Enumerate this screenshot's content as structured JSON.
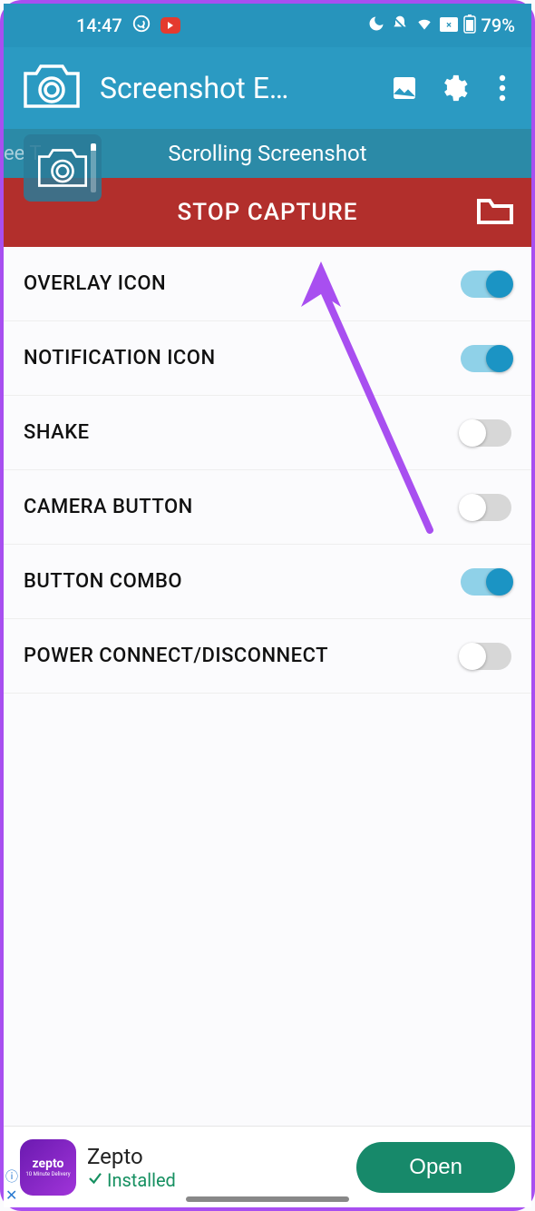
{
  "status": {
    "time": "14:47",
    "battery": "79%"
  },
  "appbar": {
    "title": "Screenshot E…"
  },
  "subheader": {
    "left_text": "ee T",
    "title": "Scrolling Screenshot"
  },
  "stop": {
    "label": "STOP CAPTURE"
  },
  "settings": [
    {
      "label": "OVERLAY ICON",
      "on": true
    },
    {
      "label": "NOTIFICATION ICON",
      "on": true
    },
    {
      "label": "SHAKE",
      "on": false
    },
    {
      "label": "CAMERA BUTTON",
      "on": false
    },
    {
      "label": "BUTTON COMBO",
      "on": true
    },
    {
      "label": "POWER CONNECT/DISCONNECT",
      "on": false
    }
  ],
  "ad": {
    "logo_text": "zepto",
    "logo_sub": "10 Minute Delivery",
    "title": "Zepto",
    "subtitle": "Installed",
    "button": "Open"
  }
}
